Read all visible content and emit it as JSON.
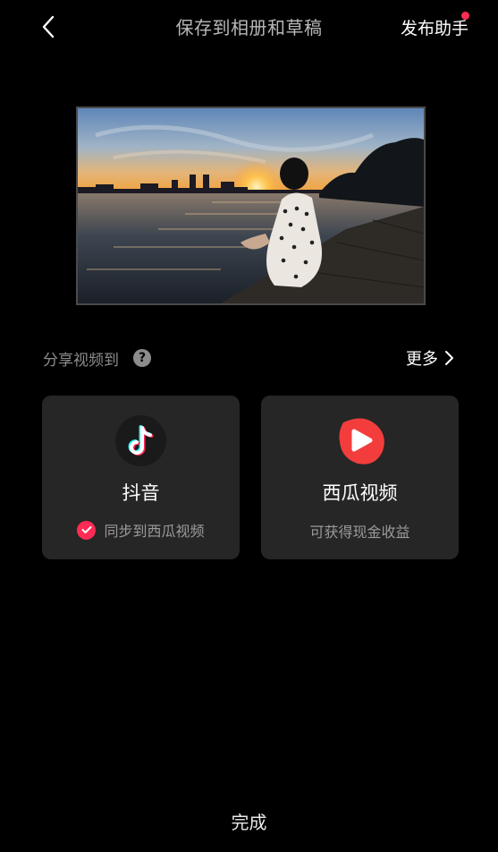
{
  "header": {
    "title": "保存到相册和草稿",
    "assistant_label": "发布助手",
    "back_icon": "chevron-left-icon",
    "notification_color": "#fe2c55"
  },
  "preview": {
    "icon": "video-thumbnail"
  },
  "share": {
    "label": "分享视频到",
    "help_icon": "question-icon",
    "more_label": "更多",
    "more_icon": "chevron-right-icon"
  },
  "targets": [
    {
      "name": "抖音",
      "icon": "douyin-logo-icon",
      "sync_label": "同步到西瓜视频",
      "sync_checked": true
    },
    {
      "name": "西瓜视频",
      "icon": "xigua-logo-icon",
      "description": "可获得现金收益"
    }
  ],
  "footer": {
    "done_label": "完成"
  },
  "colors": {
    "accent": "#fe2c55",
    "card_background": "#262626",
    "background": "#000000"
  }
}
